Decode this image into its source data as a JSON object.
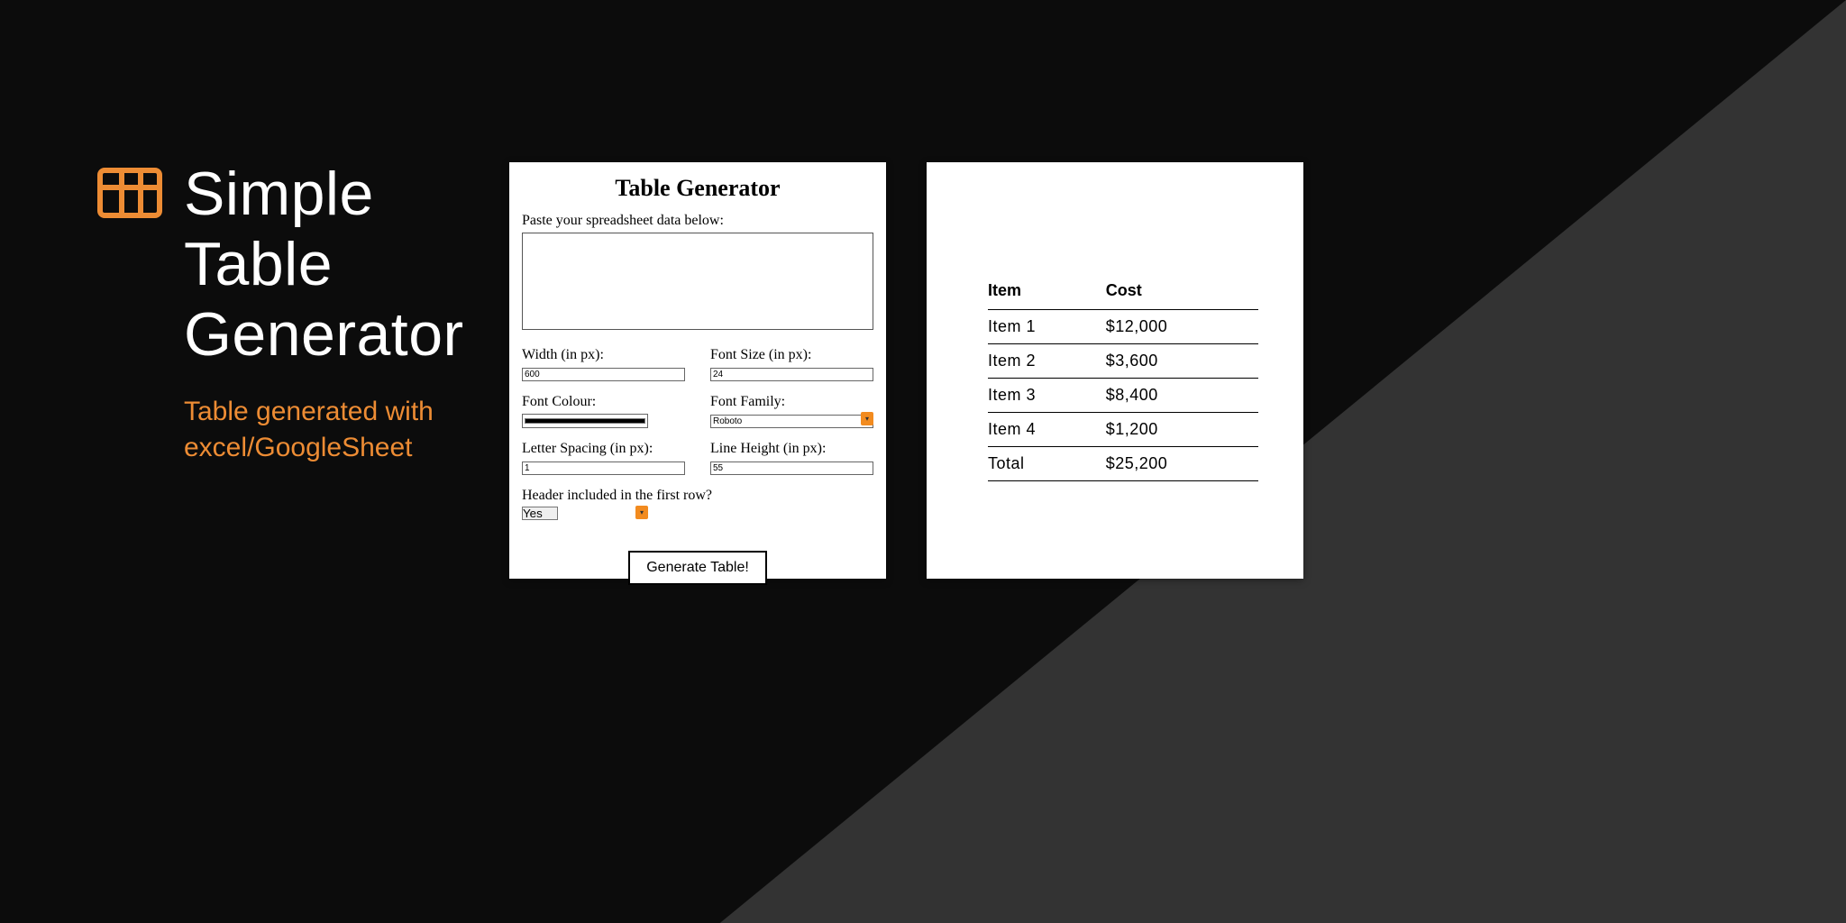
{
  "hero": {
    "title_line1": "Simple",
    "title_line2": "Table",
    "title_line3": "Generator",
    "subtitle_line1": "Table generated with",
    "subtitle_line2": "excel/GoogleSheet"
  },
  "form": {
    "title": "Table Generator",
    "paste_label": "Paste your spreadsheet data below:",
    "fields": {
      "width": {
        "label": "Width (in px):",
        "value": "600"
      },
      "font_size": {
        "label": "Font Size (in px):",
        "value": "24"
      },
      "font_colour": {
        "label": "Font Colour:",
        "value": "#000000"
      },
      "font_family": {
        "label": "Font Family:",
        "value": "Roboto"
      },
      "letter_spacing": {
        "label": "Letter Spacing (in px):",
        "value": "1"
      },
      "line_height": {
        "label": "Line Height (in px):",
        "value": "55"
      },
      "header_row": {
        "label": "Header included in the first row?",
        "value": "Yes"
      }
    },
    "submit_label": "Generate Table!"
  },
  "result": {
    "headers": [
      "Item",
      "Cost"
    ],
    "rows": [
      [
        "Item 1",
        "$12,000"
      ],
      [
        "Item 2",
        "$3,600"
      ],
      [
        "Item 3",
        "$8,400"
      ],
      [
        "Item 4",
        "$1,200"
      ],
      [
        "Total",
        "$25,200"
      ]
    ]
  },
  "colors": {
    "accent": "#ed8c34"
  }
}
